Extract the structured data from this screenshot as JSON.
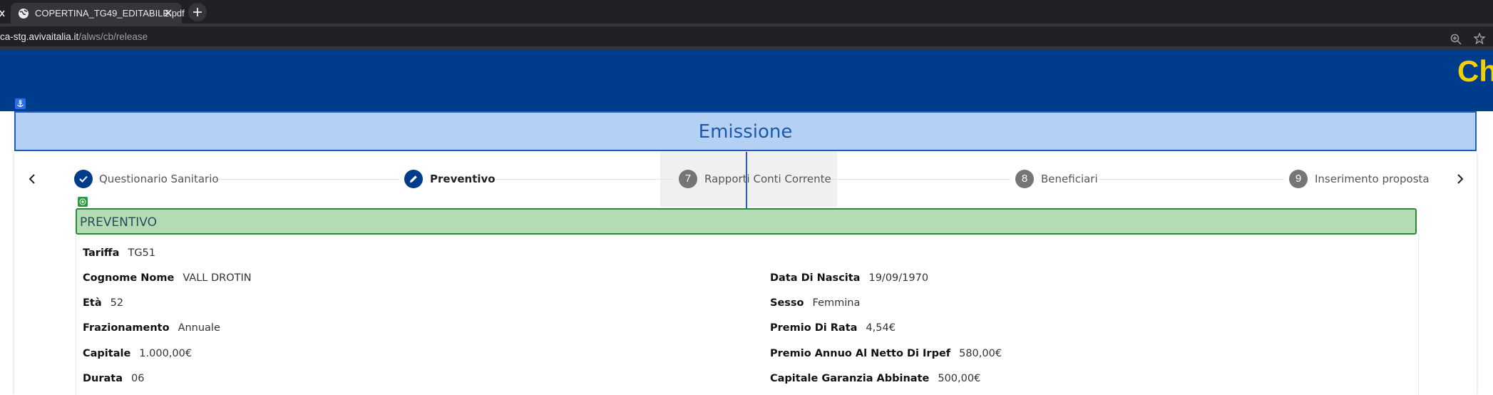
{
  "browser": {
    "tab_title": "COPERTINA_TG49_EDITABILE.pdf",
    "url_host": "ca-stg.avivaitalia.it",
    "url_path": "/alws/cb/release"
  },
  "header": {
    "brand_fragment": "Ch",
    "section_title": "Emissione"
  },
  "colors": {
    "header_bg": "#003c8c",
    "brand_yellow": "#f5d000",
    "step_done": "#003c8c",
    "step_pending": "#757575",
    "section_green": "#b4dcb4"
  },
  "stepper": {
    "steps": [
      {
        "label": "Questionario Sanitario",
        "state": "done",
        "icon": "check-icon"
      },
      {
        "label": "Preventivo",
        "state": "active",
        "icon": "pencil-icon"
      },
      {
        "number": "7",
        "label": "Rapporti Conti Corrente",
        "state": "pending"
      },
      {
        "number": "8",
        "label": "Beneficiari",
        "state": "pending"
      },
      {
        "number": "9",
        "label": "Inserimento proposta",
        "state": "pending"
      }
    ]
  },
  "preventivo": {
    "title": "PREVENTIVO",
    "left": [
      {
        "label": "Tariffa",
        "value": "TG51"
      },
      {
        "label": "Cognome Nome",
        "value": "VALL DROTIN"
      },
      {
        "label": "Età",
        "value": "52"
      },
      {
        "label": "Frazionamento",
        "value": "Annuale"
      },
      {
        "label": "Capitale",
        "value": "1.000,00€"
      },
      {
        "label": "Durata",
        "value": "06"
      }
    ],
    "right": [
      {
        "label": "Data Di Nascita",
        "value": "19/09/1970"
      },
      {
        "label": "Sesso",
        "value": "Femmina"
      },
      {
        "label": "Premio Di Rata",
        "value": "4,54€"
      },
      {
        "label": "Premio Annuo Al Netto Di Irpef",
        "value": "580,00€"
      },
      {
        "label": "Capitale Garanzia Abbinate",
        "value": "500,00€"
      }
    ]
  }
}
